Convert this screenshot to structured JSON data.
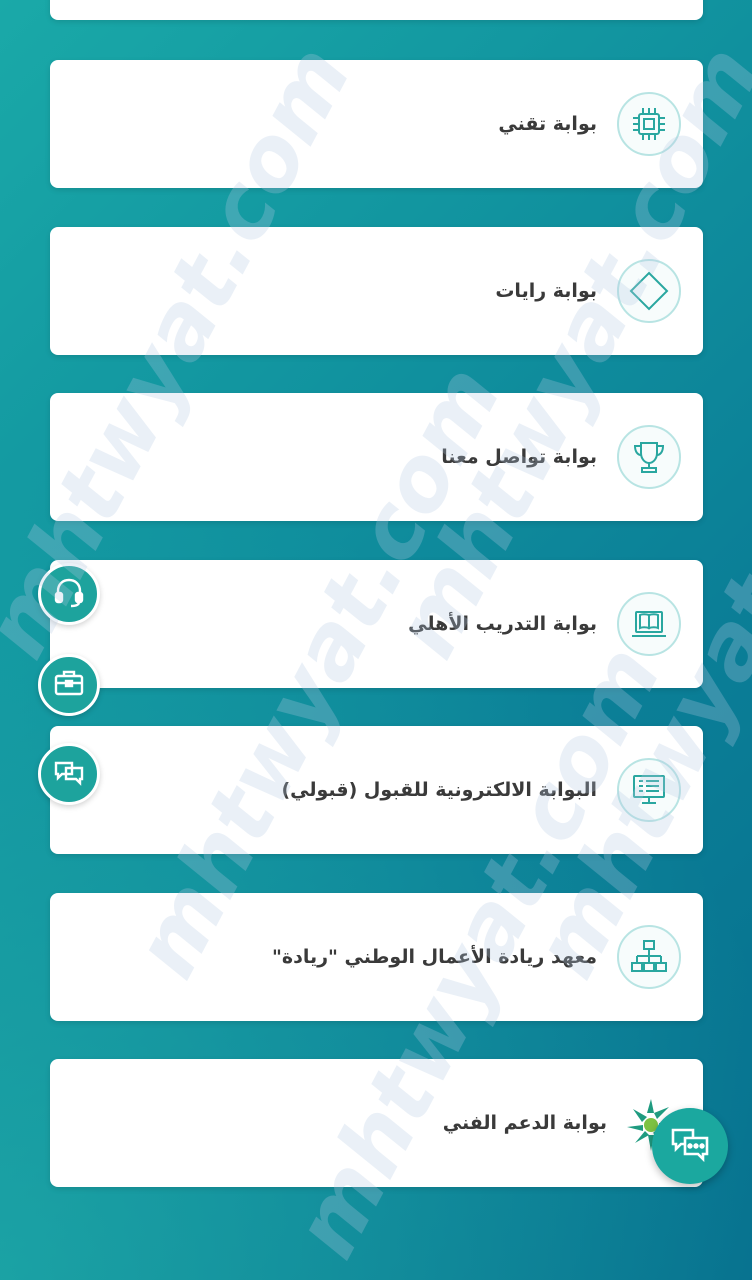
{
  "portals": [
    {
      "label": "بوابة تقني",
      "icon": "chip-icon"
    },
    {
      "label": "بوابة رايات",
      "icon": "diamond-icon"
    },
    {
      "label": "بوابة تواصل معنا",
      "icon": "trophy-icon"
    },
    {
      "label": "بوابة التدريب الأهلي",
      "icon": "book-laptop-icon"
    },
    {
      "label": "البوابة الالكترونية للقبول (قبولي)",
      "icon": "monitor-form-icon"
    },
    {
      "label": "معهد ريادة الأعمال الوطني \"ريادة\"",
      "icon": "org-chart-icon"
    },
    {
      "label": "بوابة الدعم الفني",
      "icon": "support-logo-icon"
    }
  ],
  "floating_buttons": [
    "headset-icon",
    "briefcase-icon",
    "chat-bubbles-icon"
  ],
  "chat_fab_icon": "chat-icon",
  "watermark": "mhtwyat.com",
  "colors": {
    "accent": "#1da39d",
    "text": "#3a3a3a",
    "background_start": "#1aa9a8",
    "background_end": "#066f8e"
  }
}
